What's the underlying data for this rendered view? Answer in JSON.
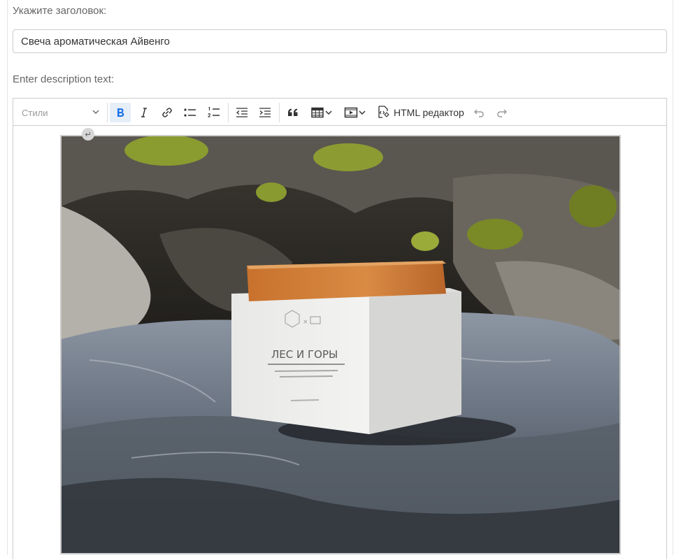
{
  "form": {
    "title_label": "Укажите заголовок:",
    "title_value": "Свеча ароматическая Айвенго",
    "description_label": "Enter description text:"
  },
  "toolbar": {
    "styles_label": "Стили",
    "html_editor_label": "HTML редактор",
    "icons": [
      "bold-icon",
      "italic-icon",
      "link-icon",
      "bulleted-list-icon",
      "numbered-list-icon",
      "outdent-icon",
      "indent-icon",
      "blockquote-icon",
      "table-icon",
      "media-icon",
      "html-source-icon",
      "undo-icon",
      "redo-icon"
    ],
    "accent_color": "#1a73e8"
  },
  "content": {
    "image_subject": "aromatic candle",
    "product_label": "ЛЕС И ГОРЫ"
  }
}
